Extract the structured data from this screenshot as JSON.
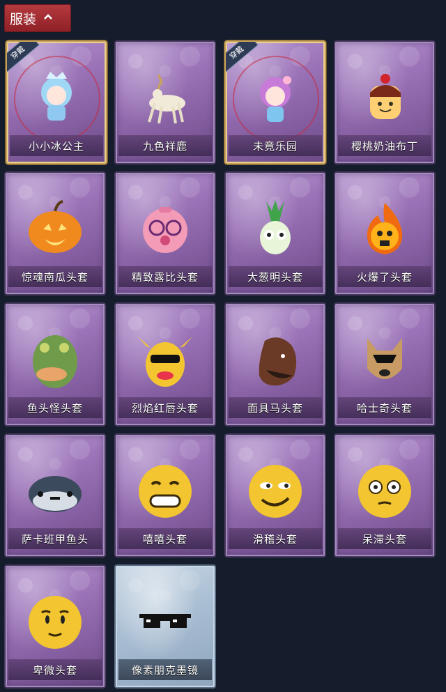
{
  "section": {
    "title": "服装",
    "chevron": "chevron-up-icon"
  },
  "items": [
    {
      "name": "小小冰公主",
      "badge": "穿戴",
      "icon": "ice-princess-doll",
      "style": "equipped"
    },
    {
      "name": "九色祥鹿",
      "badge": "",
      "icon": "nine-color-deer",
      "style": "normal"
    },
    {
      "name": "未竟乐园",
      "badge": "穿戴",
      "icon": "paradise-girl-doll",
      "style": "equipped"
    },
    {
      "name": "樱桃奶油布丁",
      "badge": "",
      "icon": "cherry-pudding",
      "style": "normal"
    },
    {
      "name": "惊魂南瓜头套",
      "badge": "",
      "icon": "pumpkin-head",
      "style": "normal"
    },
    {
      "name": "精致露比头套",
      "badge": "",
      "icon": "pink-beaver-head",
      "style": "normal"
    },
    {
      "name": "大葱明头套",
      "badge": "",
      "icon": "green-onion-head",
      "style": "normal"
    },
    {
      "name": "火爆了头套",
      "badge": "",
      "icon": "fire-head",
      "style": "normal"
    },
    {
      "name": "鱼头怪头套",
      "badge": "",
      "icon": "fish-head",
      "style": "normal"
    },
    {
      "name": "烈焰红唇头套",
      "badge": "",
      "icon": "yellow-pikachu-head",
      "style": "normal"
    },
    {
      "name": "面具马头套",
      "badge": "",
      "icon": "horse-head",
      "style": "normal"
    },
    {
      "name": "哈士奇头套",
      "badge": "",
      "icon": "husky-head",
      "style": "normal"
    },
    {
      "name": "萨卡班甲鱼头",
      "badge": "",
      "icon": "sacabambaspis-head",
      "style": "normal"
    },
    {
      "name": "嘻嘻头套",
      "badge": "",
      "icon": "grin-emoji-head",
      "style": "normal"
    },
    {
      "name": "滑稽头套",
      "badge": "",
      "icon": "funny-emoji-head",
      "style": "normal"
    },
    {
      "name": "呆滞头套",
      "badge": "",
      "icon": "dazed-emoji-head",
      "style": "normal"
    },
    {
      "name": "卑微头套",
      "badge": "",
      "icon": "humble-emoji-head",
      "style": "normal"
    },
    {
      "name": "像素朋克墨镜",
      "badge": "",
      "icon": "pixel-sunglasses",
      "style": "glass"
    }
  ],
  "colors": {
    "background": "#151d2d",
    "header_red": "#b53a3f",
    "card_purple": "#9b73b8",
    "equipped_gold": "#c9a25a"
  }
}
